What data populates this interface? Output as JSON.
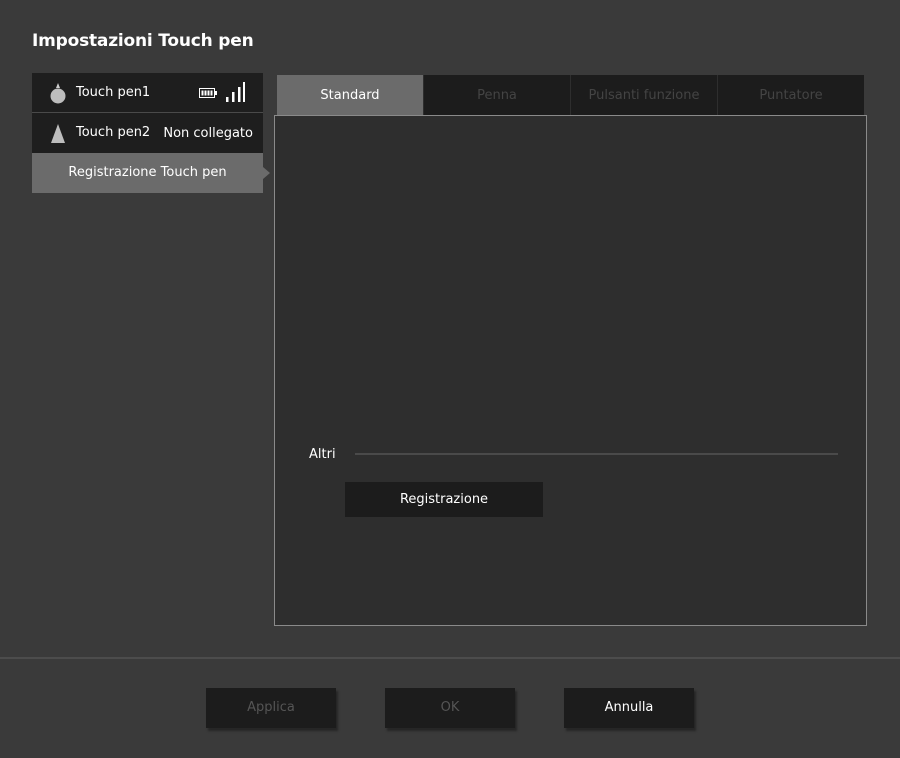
{
  "window": {
    "title": "Impostazioni Touch pen"
  },
  "sidebar": {
    "pens": [
      {
        "name": "Touch pen1",
        "status": "",
        "icon": "pen-circle-icon",
        "battery_icon": "battery-full-icon",
        "signal_icon": "signal-strength-icon"
      },
      {
        "name": "Touch pen2",
        "status": "Non collegato",
        "icon": "pen-triangle-icon"
      }
    ],
    "registration_item": "Registrazione Touch pen"
  },
  "tabs": [
    {
      "label": "Standard",
      "active": true
    },
    {
      "label": "Penna",
      "active": false
    },
    {
      "label": "Pulsanti funzione",
      "active": false
    },
    {
      "label": "Puntatore",
      "active": false
    }
  ],
  "panel": {
    "others_label": "Altri",
    "registration_button": "Registrazione"
  },
  "footer": {
    "apply_label": "Applica",
    "ok_label": "OK",
    "cancel_label": "Annulla"
  },
  "colors": {
    "background": "#3a3a3a",
    "dark_surface": "#1c1c1c",
    "selected": "#6b6b6b",
    "disabled_text": "#555555"
  }
}
